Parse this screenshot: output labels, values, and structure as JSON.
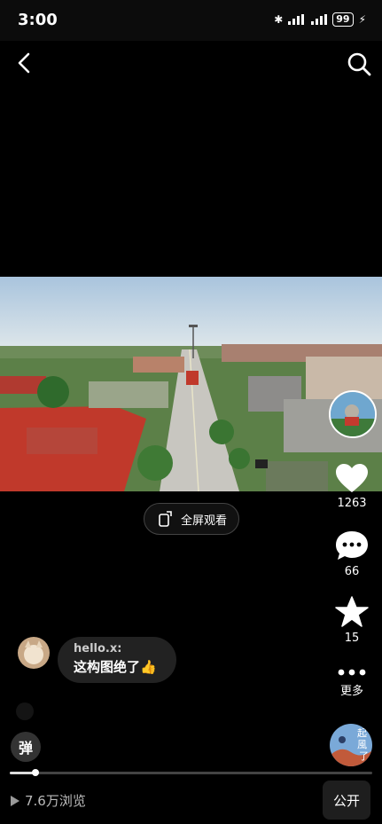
{
  "status_bar": {
    "time": "3:00",
    "battery": "99"
  },
  "video": {
    "fullscreen_label": "全屏观看"
  },
  "actions": {
    "likes": "1263",
    "comments": "66",
    "favorites": "15",
    "more": "更多"
  },
  "comment": {
    "user": "hello.x:",
    "text": "这构图绝了👍"
  },
  "danmu_label": "弹",
  "music_avatar_text": "起風了",
  "playback": {
    "progress": 0.07
  },
  "footer": {
    "views": "7.6万浏览",
    "public_label": "公开"
  },
  "colors": {
    "roof": "#c8382e",
    "sky": "#cfe0f0",
    "tree": "#3f7a35"
  }
}
